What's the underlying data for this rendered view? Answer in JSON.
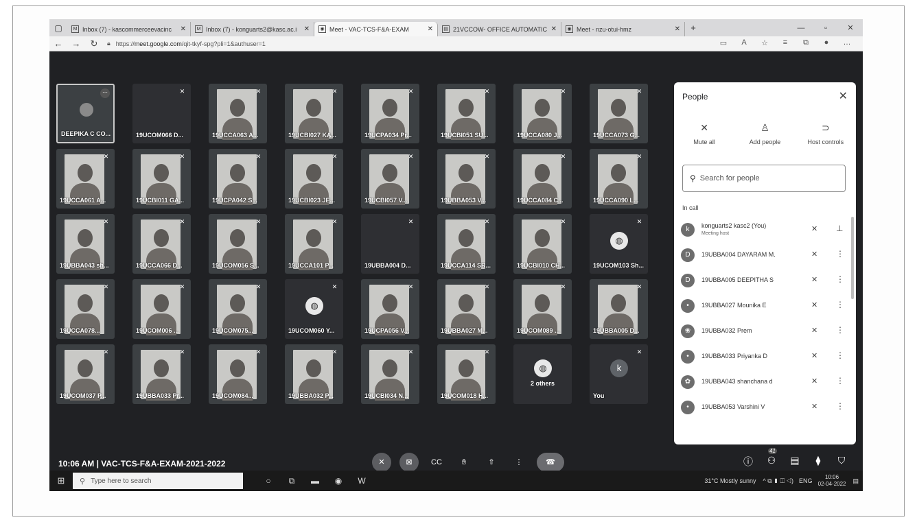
{
  "browser": {
    "tabs": [
      {
        "icon": "M",
        "title": "Inbox (7) - kascommerceevacinc"
      },
      {
        "icon": "M",
        "title": "Inbox (7) - konguarts2@kasc.ac.i"
      },
      {
        "icon": "◉",
        "title": "Meet - VAC-TCS-F&A-EXAM",
        "active": true
      },
      {
        "icon": "▤",
        "title": "21VCCOW- OFFICE AUTOMATIC"
      },
      {
        "icon": "◉",
        "title": "Meet - nzu-otui-hmz"
      }
    ],
    "url_prefix": "https://",
    "url_host": "meet.google.com",
    "url_path": "/qit-tkyf-spg?pli=1&authuser=1"
  },
  "tiles": [
    {
      "name": "DEEPIKA C CO...",
      "type": "globe",
      "pinned": true
    },
    {
      "name": "19UCOM066 D...",
      "type": "dark"
    },
    {
      "name": "19UCCA063 A...",
      "type": "cam"
    },
    {
      "name": "19UCBI027 KA...",
      "type": "cam"
    },
    {
      "name": "19UCPA034 Pr...",
      "type": "cam"
    },
    {
      "name": "19UCBI051 SU...",
      "type": "cam"
    },
    {
      "name": "19UCCA080 J...",
      "type": "cam"
    },
    {
      "name": "19UCCA073 G...",
      "type": "cam"
    },
    {
      "name": "19UCCA061 A...",
      "type": "cam"
    },
    {
      "name": "19UCBI011 GA...",
      "type": "cam"
    },
    {
      "name": "19UCPA042 S...",
      "type": "cam"
    },
    {
      "name": "19UCBI023 JE...",
      "type": "cam"
    },
    {
      "name": "19UCBI057 V...",
      "type": "cam"
    },
    {
      "name": "19UBBA053 V...",
      "type": "cam"
    },
    {
      "name": "19UCCA084 C...",
      "type": "cam"
    },
    {
      "name": "19UCCA090 L...",
      "type": "cam"
    },
    {
      "name": "19UBBA043 sh...",
      "type": "cam"
    },
    {
      "name": "19UCCA066 D...",
      "type": "cam"
    },
    {
      "name": "19UCOM056 S...",
      "type": "cam"
    },
    {
      "name": "19UCCA101 P...",
      "type": "cam"
    },
    {
      "name": "19UBBA004 D...",
      "type": "dark"
    },
    {
      "name": "19UCCA114 SR...",
      "type": "cam"
    },
    {
      "name": "19UCBI010 CH...",
      "type": "cam"
    },
    {
      "name": "19UCOM103 Sh...",
      "type": "avatar",
      "initial": "◍"
    },
    {
      "name": "19UCCA078...",
      "type": "cam"
    },
    {
      "name": "19UCOM006 ...",
      "type": "cam"
    },
    {
      "name": "19UCOM075...",
      "type": "cam"
    },
    {
      "name": "19UCOM060 Y...",
      "type": "avatar",
      "initial": "◍"
    },
    {
      "name": "19UCPA056 V...",
      "type": "cam"
    },
    {
      "name": "19UBBA027 M...",
      "type": "cam"
    },
    {
      "name": "19UCOM089 ...",
      "type": "cam"
    },
    {
      "name": "19UBBA005 D...",
      "type": "cam"
    },
    {
      "name": "19UCOM037 P...",
      "type": "cam"
    },
    {
      "name": "19UBBA033 Pr...",
      "type": "cam"
    },
    {
      "name": "19UCOM084...",
      "type": "cam"
    },
    {
      "name": "19UBBA032 P...",
      "type": "cam"
    },
    {
      "name": "19UCBI034 N...",
      "type": "cam"
    },
    {
      "name": "19UCOM018 H...",
      "type": "cam"
    },
    {
      "name": "2 others",
      "type": "others"
    },
    {
      "name": "You",
      "type": "you",
      "initial": "k"
    }
  ],
  "people": {
    "title": "People",
    "actions": [
      {
        "icon": "mic-off-icon",
        "glyph": "✕",
        "label": "Mute all"
      },
      {
        "icon": "add-person-icon",
        "glyph": "♙",
        "label": "Add people"
      },
      {
        "icon": "toggle-icon",
        "glyph": "⊃",
        "label": "Host controls"
      }
    ],
    "search_placeholder": "Search for people",
    "section": "In call",
    "list": [
      {
        "initial": "k",
        "name": "konguarts2 kasc2 (You)",
        "sub": "Meeting host",
        "host": true
      },
      {
        "initial": "D",
        "name": "19UBBA004 DAYARAM M."
      },
      {
        "initial": "D",
        "name": "19UBBA005 DEEPITHA S"
      },
      {
        "initial": "•",
        "name": "19UBBA027 Mounika E"
      },
      {
        "initial": "❀",
        "name": "19UBBA032 Prem"
      },
      {
        "initial": "•",
        "name": "19UBBA033 Priyanka D"
      },
      {
        "initial": "✿",
        "name": "19UBBA043 shanchana d"
      },
      {
        "initial": "•",
        "name": "19UBBA053 Varshini V"
      }
    ]
  },
  "meeting": {
    "info": "10:06 AM | VAC-TCS-F&A-EXAM-2021-2022",
    "participant_count": "41"
  },
  "taskbar": {
    "search_placeholder": "Type here to search",
    "weather": "31°C  Mostly sunny",
    "lang": "ENG",
    "time": "10:06",
    "date": "02-04-2022"
  }
}
